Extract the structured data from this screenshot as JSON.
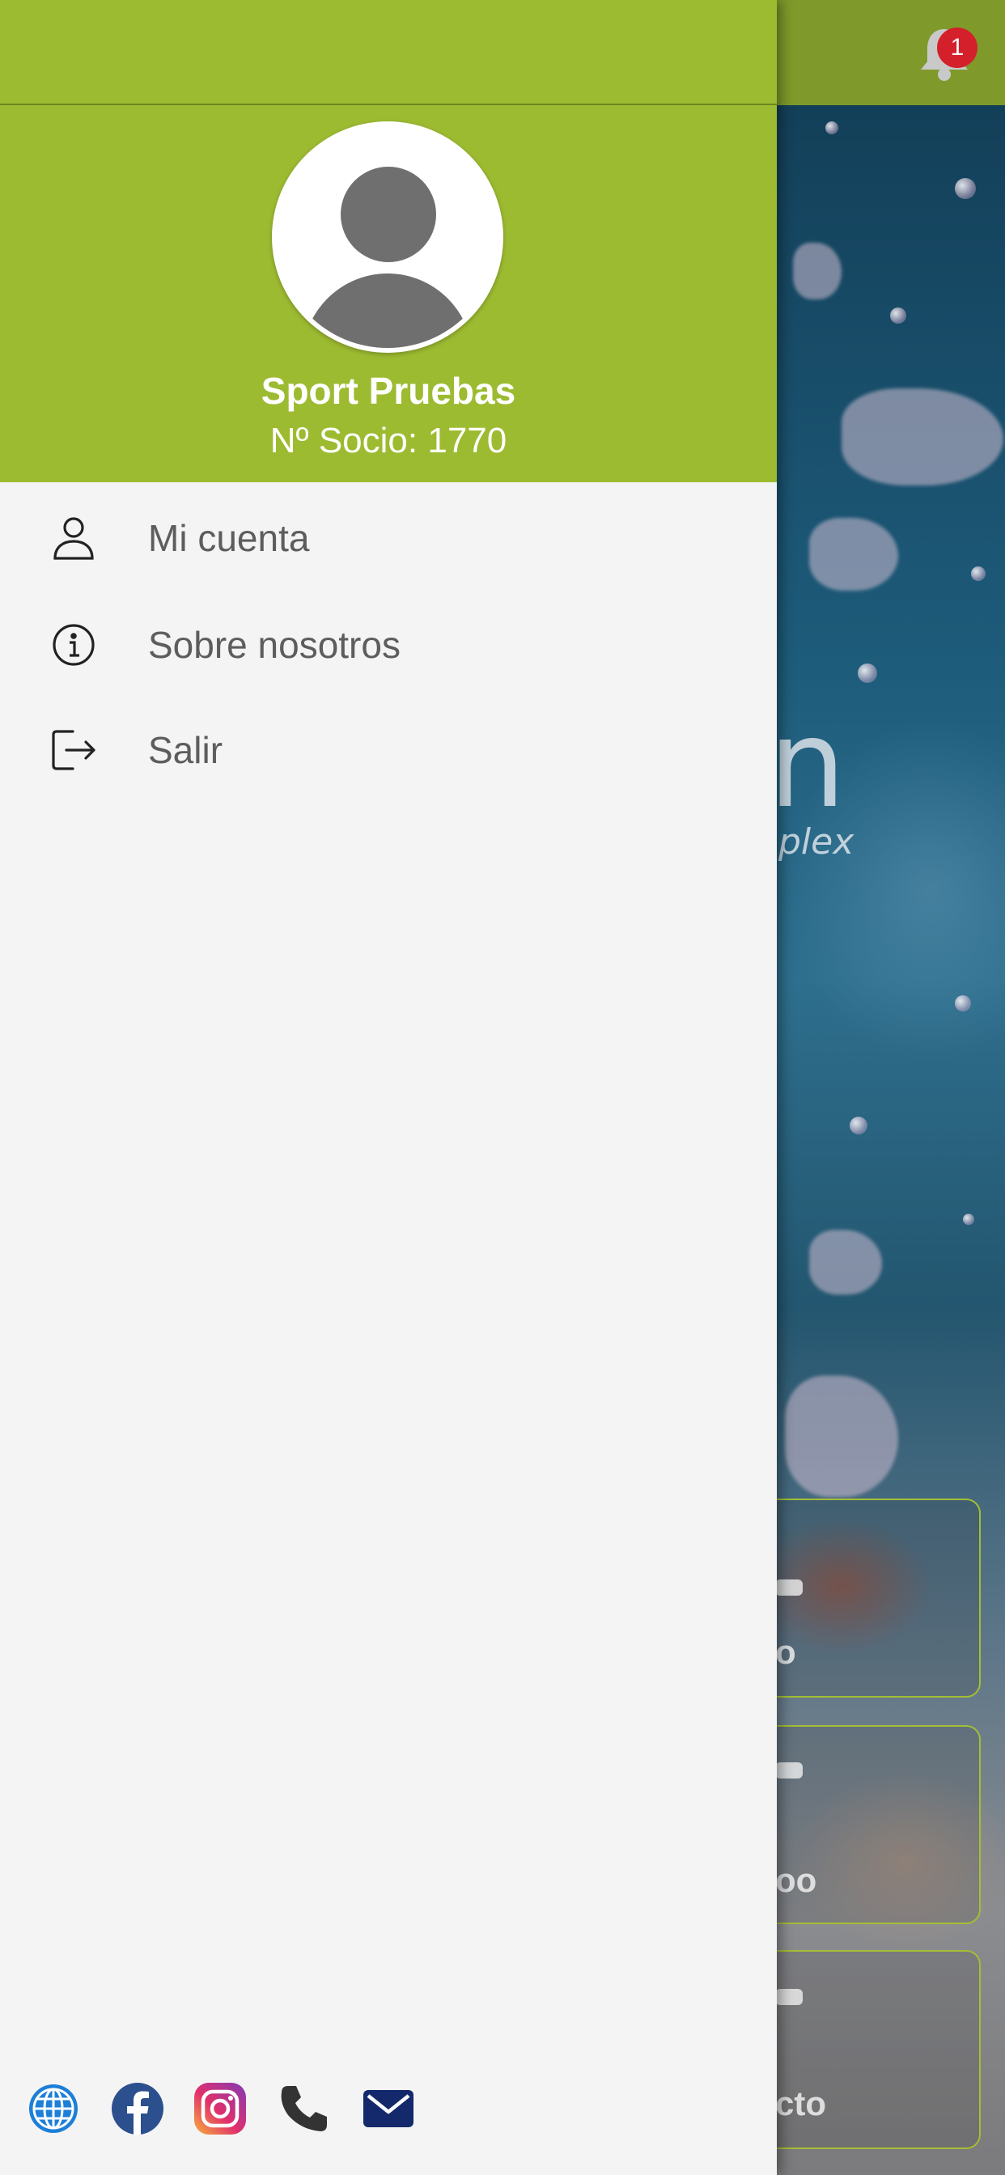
{
  "notifications": {
    "badge_count": "1"
  },
  "background": {
    "logo_fragment_letter": "n",
    "logo_fragment_sub": "plex",
    "tile_labels": [
      "o",
      "oo",
      "cto"
    ]
  },
  "profile": {
    "name": "Sport Pruebas",
    "member_number": "Nº Socio: 1770"
  },
  "menu": {
    "items": [
      {
        "label": "Mi cuenta",
        "icon": "user-icon"
      },
      {
        "label": "Sobre nosotros",
        "icon": "info-icon"
      },
      {
        "label": "Salir",
        "icon": "logout-icon"
      }
    ]
  },
  "social_links": [
    {
      "icon": "globe-icon"
    },
    {
      "icon": "facebook-icon"
    },
    {
      "icon": "instagram-icon"
    },
    {
      "icon": "phone-icon"
    },
    {
      "icon": "email-icon"
    }
  ],
  "colors": {
    "brand_green": "#9dbb31",
    "topbar_dimmed": "#7f9a2a",
    "badge_red": "#d4202b",
    "drawer_bg": "#f4f4f4",
    "menu_text": "#5d5d5d"
  }
}
